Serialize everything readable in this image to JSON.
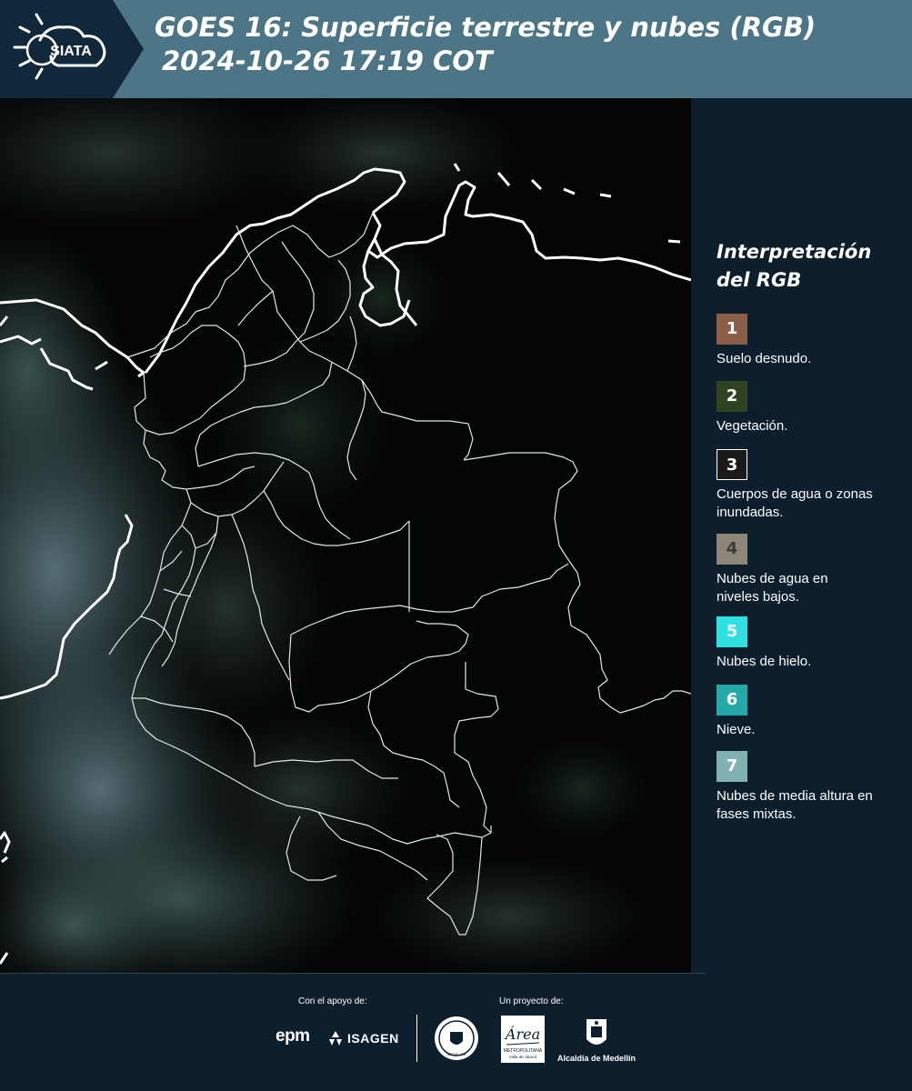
{
  "header": {
    "logo_text": "SIATA",
    "title_line1": "GOES 16: Superficie terrestre y nubes (RGB)",
    "title_line2": "2024-10-26 17:19 COT"
  },
  "legend": {
    "title_line1": "Interpretación",
    "title_line2": "del RGB",
    "items": [
      {
        "number": "1",
        "label": "Suelo desnudo.",
        "color": "#8b5e48"
      },
      {
        "number": "2",
        "label": "Vegetación.",
        "color": "#2f4322"
      },
      {
        "number": "3",
        "label": "Cuerpos de agua o zonas inundadas.",
        "color": "#1a1a1a"
      },
      {
        "number": "4",
        "label": "Nubes de agua en niveles bajos.",
        "color": "#8e8678"
      },
      {
        "number": "5",
        "label": "Nubes de hielo.",
        "color": "#2ee0e0"
      },
      {
        "number": "6",
        "label": "Nieve.",
        "color": "#25a8a8"
      },
      {
        "number": "7",
        "label": "Nubes de media altura en fases mixtas.",
        "color": "#82b1b1"
      }
    ]
  },
  "footer": {
    "support_label": "Con el apoyo de:",
    "project_label": "Un proyecto de:",
    "epm": "epm",
    "isagen": "ISAGEN",
    "area_top": "Área",
    "area_sub1": "METROPOLITANA",
    "area_sub2": "Valle de Aburrá",
    "alcaldia": "Alcaldía de Medellín",
    "seal_text": "MEDELLÍN"
  }
}
